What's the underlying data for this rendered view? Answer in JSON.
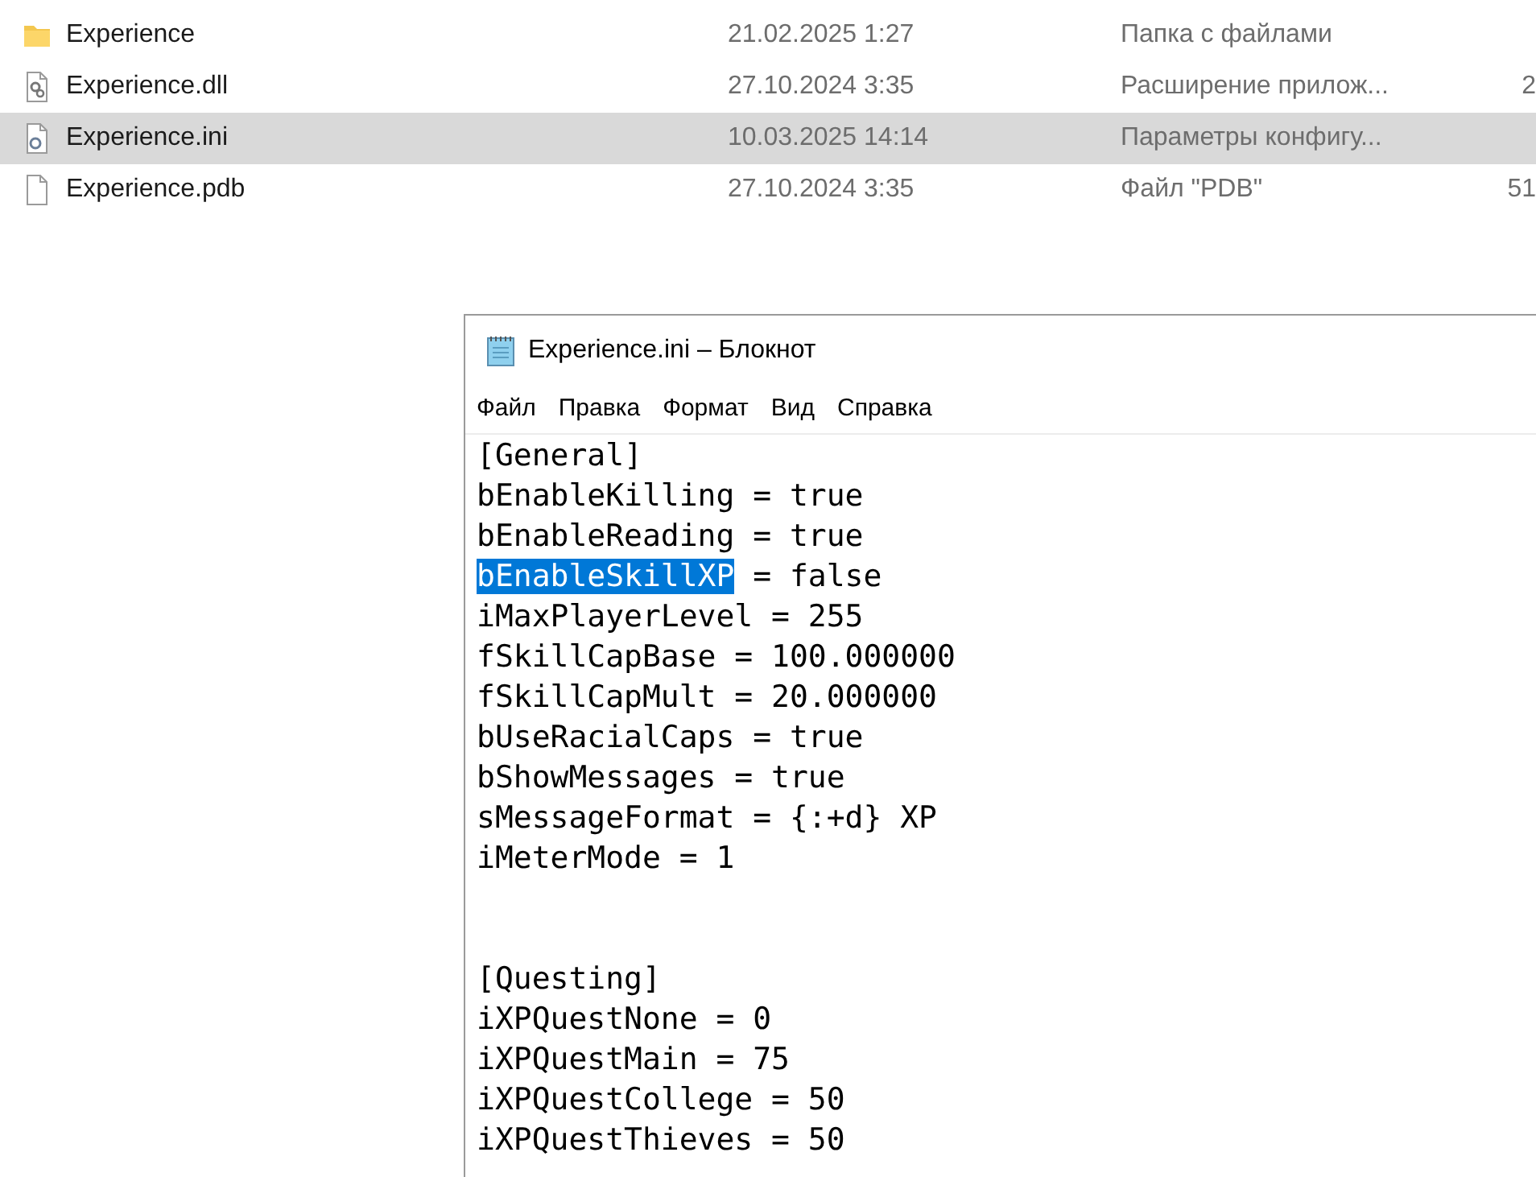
{
  "explorer": {
    "rows": [
      {
        "kind": "folder",
        "name": "Experience",
        "date": "21.02.2025 1:27",
        "type": "Папка с файлами",
        "selected": false
      },
      {
        "kind": "dll",
        "name": "Experience.dll",
        "date": "27.10.2024 3:35",
        "type": "Расширение прилож...",
        "size": "2",
        "selected": false
      },
      {
        "kind": "ini",
        "name": "Experience.ini",
        "date": "10.03.2025 14:14",
        "type": "Параметры конфигу...",
        "selected": true
      },
      {
        "kind": "file",
        "name": "Experience.pdb",
        "date": "27.10.2024 3:35",
        "type": "Файл \"PDB\"",
        "size": "51",
        "selected": false
      }
    ]
  },
  "notepad": {
    "title": "Experience.ini – Блокнот",
    "menu": [
      "Файл",
      "Правка",
      "Формат",
      "Вид",
      "Справка"
    ],
    "lines": [
      {
        "kind": "text",
        "text": "[General]"
      },
      {
        "kind": "text",
        "text": "bEnableKilling = true"
      },
      {
        "kind": "text",
        "text": "bEnableReading = true"
      },
      {
        "kind": "text",
        "selection": "bEnableSkillXP",
        "text": " = false"
      },
      {
        "kind": "text",
        "text": "iMaxPlayerLevel = 255"
      },
      {
        "kind": "text",
        "text": "fSkillCapBase = 100.000000"
      },
      {
        "kind": "text",
        "text": "fSkillCapMult = 20.000000"
      },
      {
        "kind": "text",
        "text": "bUseRacialCaps = true"
      },
      {
        "kind": "text",
        "text": "bShowMessages = true"
      },
      {
        "kind": "text",
        "text": "sMessageFormat = {:+d} XP"
      },
      {
        "kind": "text",
        "text": "iMeterMode = 1"
      },
      {
        "kind": "blank"
      },
      {
        "kind": "blank"
      },
      {
        "kind": "text",
        "text": "[Questing]"
      },
      {
        "kind": "text",
        "text": "iXPQuestNone = 0"
      },
      {
        "kind": "text",
        "text": "iXPQuestMain = 75"
      },
      {
        "kind": "text",
        "text": "iXPQuestCollege = 50"
      },
      {
        "kind": "text",
        "text": "iXPQuestThieves = 50"
      }
    ]
  }
}
